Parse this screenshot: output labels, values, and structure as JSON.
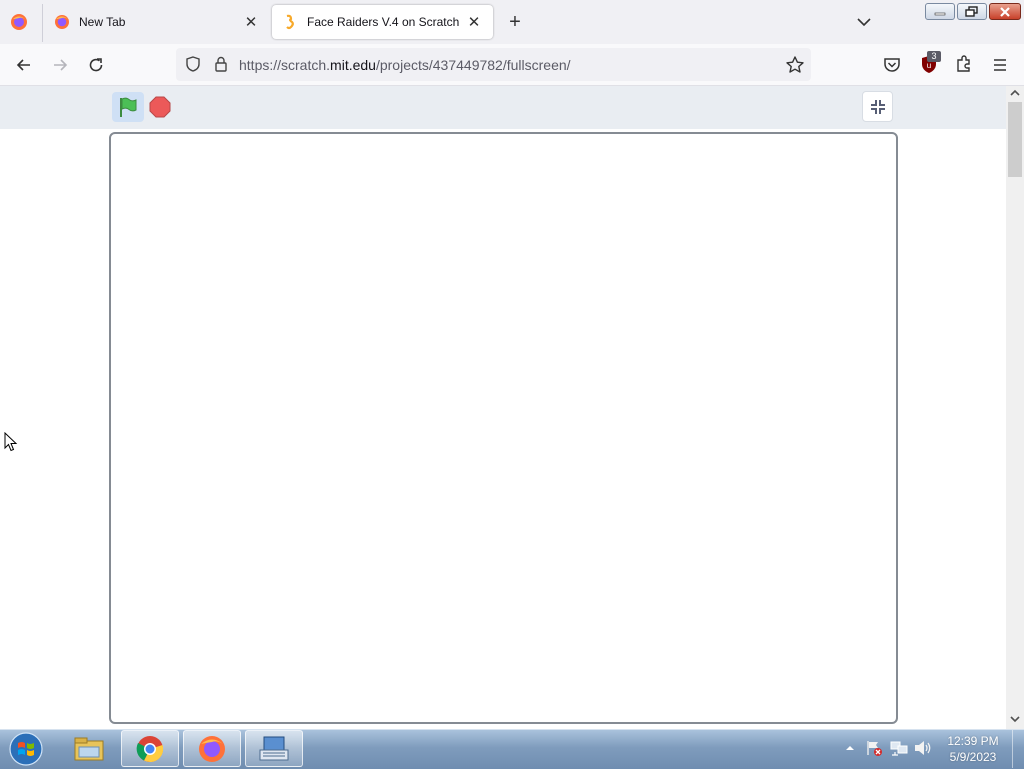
{
  "browser": {
    "tabs": [
      {
        "title": "New Tab",
        "active": false
      },
      {
        "title": "Face Raiders V.4 on Scratch",
        "active": true
      }
    ],
    "url": {
      "prefix": "https://scratch.",
      "domain": "mit.edu",
      "path": "/projects/437449782/fullscreen/"
    },
    "extension_badge": "3"
  },
  "scratch": {
    "flag_color": "#4cbf56",
    "stop_color": "#ec5959"
  },
  "taskbar": {
    "clock_time": "12:39 PM",
    "clock_date": "5/9/2023"
  }
}
